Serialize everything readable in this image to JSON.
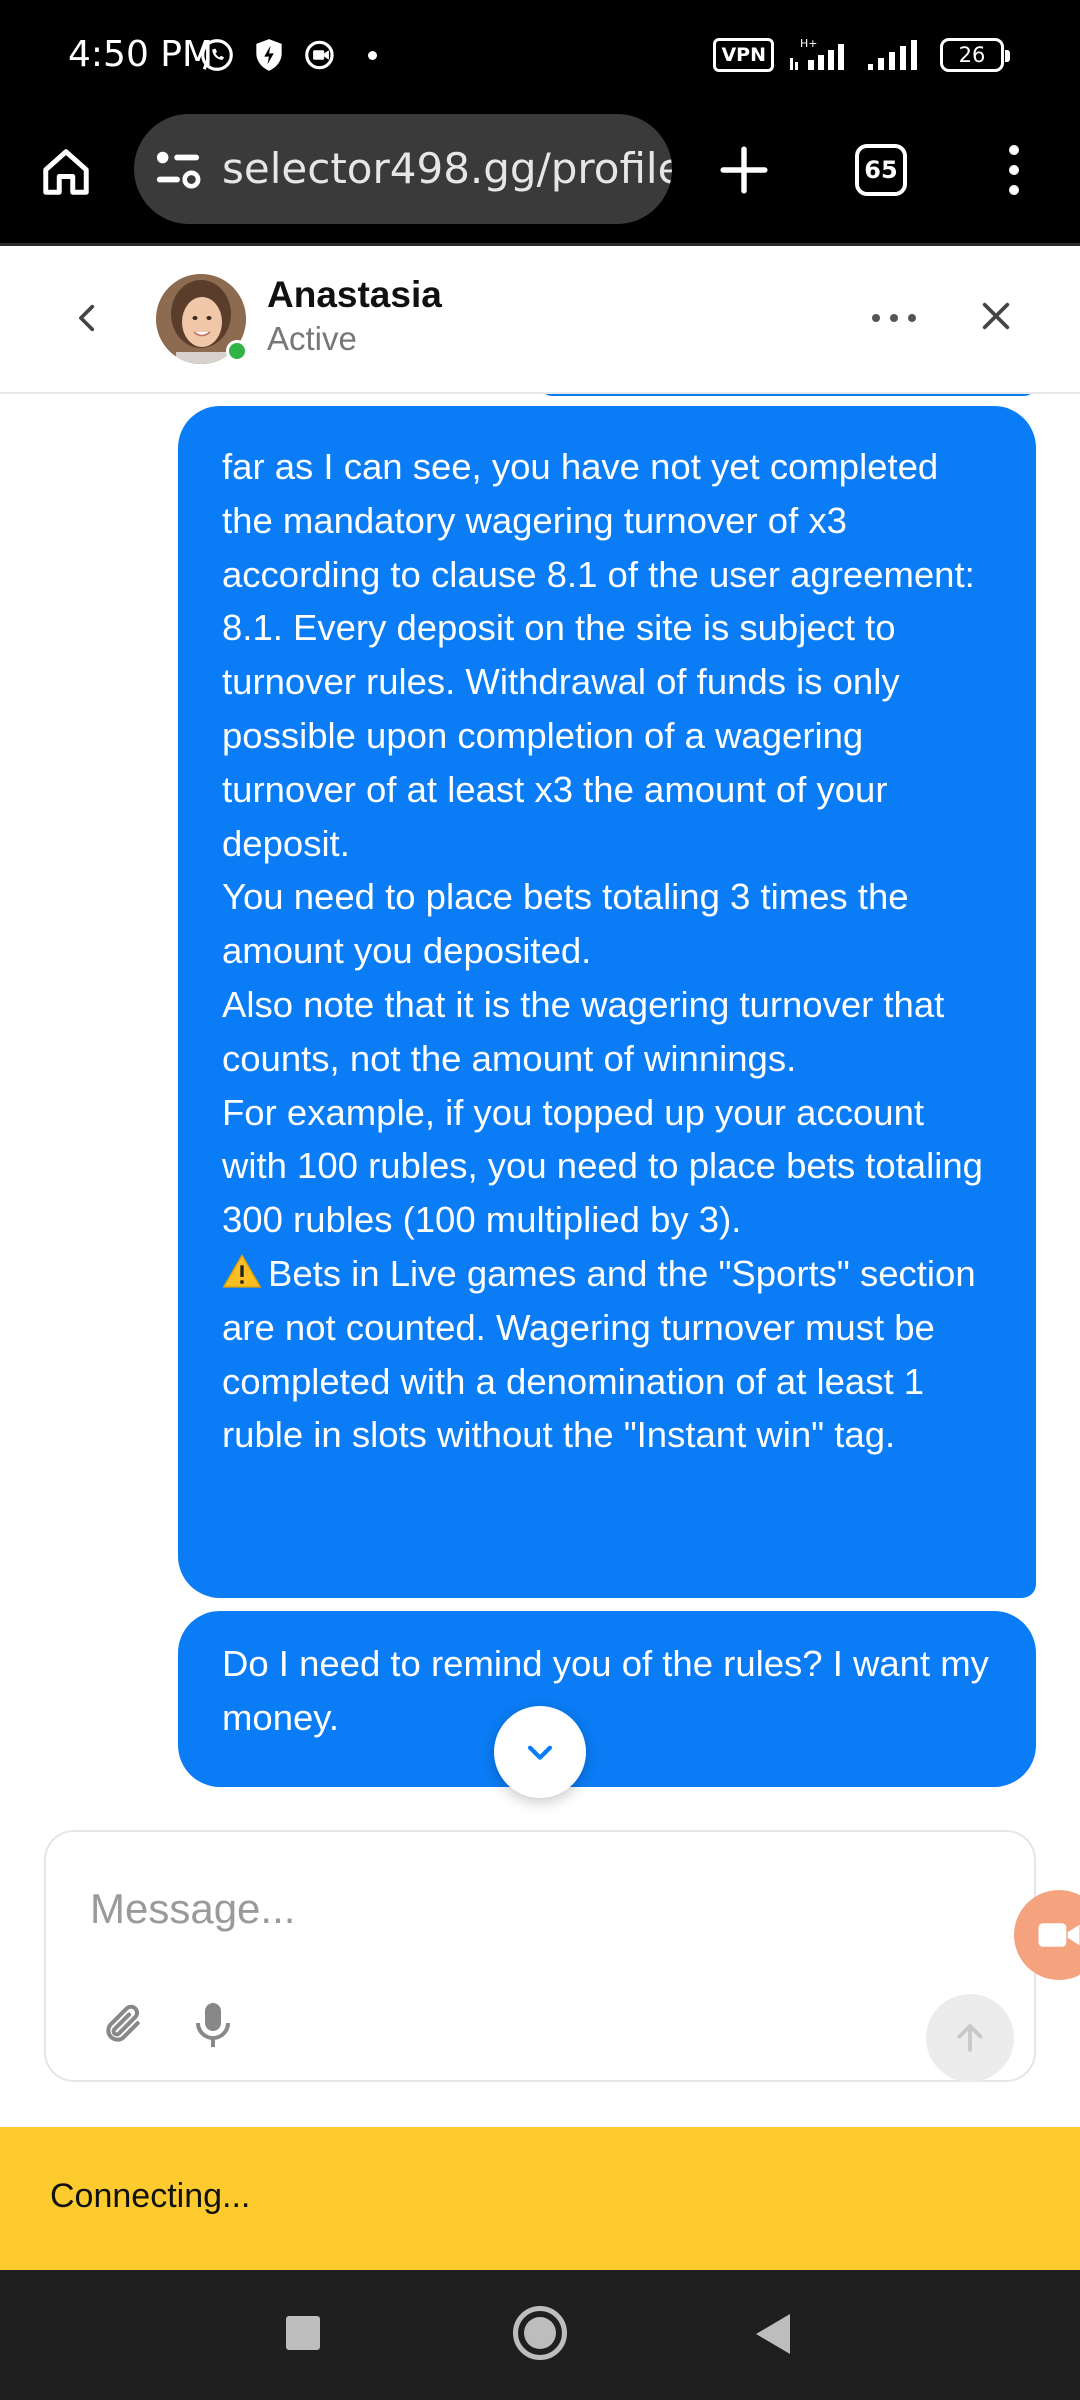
{
  "status_bar": {
    "time": "4:50 PM",
    "vpn_label": "VPN",
    "battery": "26",
    "network_label": "H+"
  },
  "browser": {
    "url": "selector498.gg/profile",
    "tab_count": "65"
  },
  "chat_header": {
    "name": "Anastasia",
    "status": "Active"
  },
  "messages": [
    {
      "lines": [
        "far as I can see, you have not yet completed the mandatory wagering turnover of x3 according to clause 8.1 of the user agreement:",
        "8.1. Every deposit on the site is subject to turnover rules. Withdrawal of funds is only possible upon completion of a wagering turnover of at least x3 the amount of your deposit.",
        "You need to place bets totaling 3 times the amount you deposited.",
        "Also note that it is the wagering turnover that counts, not the amount of winnings.",
        "For example, if you topped up your account with 100 rubles, you need to place bets totaling 300 rubles (100 multiplied by 3).",
        "Bets in Live games and the \"Sports\" section are not counted. Wagering turnover must be completed with a denomination of at least 1 ruble in slots without the \"Instant win\" tag."
      ]
    },
    {
      "lines": [
        "Do I need to remind you of the rules? I want my money."
      ]
    }
  ],
  "composer": {
    "placeholder": "Message..."
  },
  "banner": {
    "text": "Connecting..."
  },
  "colors": {
    "bubble": "#0a7cf5",
    "banner": "#fecb2f",
    "online": "#2fb344"
  },
  "icons": {
    "home": "home-icon",
    "tune": "tune-icon",
    "plus": "plus-icon",
    "more": "more-vert-icon",
    "back": "chevron-left-icon",
    "close": "close-icon",
    "warning": "warning-icon",
    "scroll": "chevron-down-icon",
    "attach": "paperclip-icon",
    "mic": "microphone-icon",
    "send": "arrow-up-icon",
    "video": "video-icon"
  }
}
